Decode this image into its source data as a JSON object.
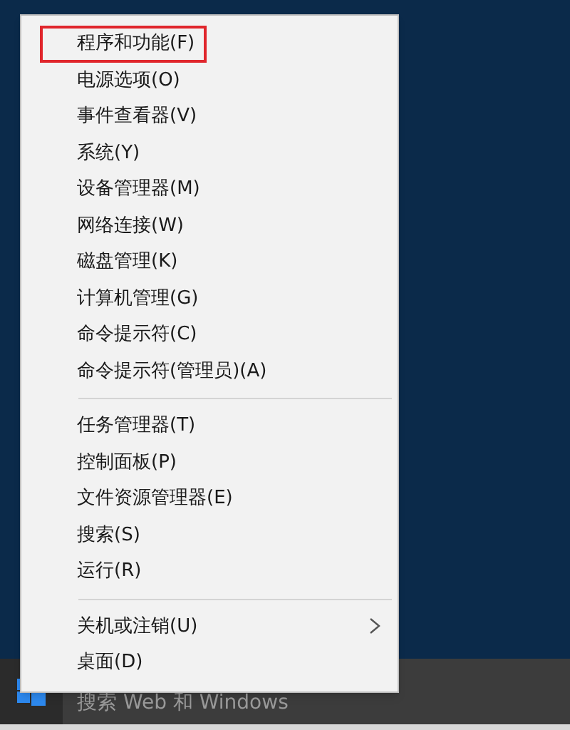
{
  "menu": {
    "groups": [
      {
        "items": [
          {
            "label": "程序和功能(F)",
            "highlighted": true,
            "has_submenu": false
          },
          {
            "label": "电源选项(O)",
            "highlighted": false,
            "has_submenu": false
          },
          {
            "label": "事件查看器(V)",
            "highlighted": false,
            "has_submenu": false
          },
          {
            "label": "系统(Y)",
            "highlighted": false,
            "has_submenu": false
          },
          {
            "label": "设备管理器(M)",
            "highlighted": false,
            "has_submenu": false
          },
          {
            "label": "网络连接(W)",
            "highlighted": false,
            "has_submenu": false
          },
          {
            "label": "磁盘管理(K)",
            "highlighted": false,
            "has_submenu": false
          },
          {
            "label": "计算机管理(G)",
            "highlighted": false,
            "has_submenu": false
          },
          {
            "label": "命令提示符(C)",
            "highlighted": false,
            "has_submenu": false
          },
          {
            "label": "命令提示符(管理员)(A)",
            "highlighted": false,
            "has_submenu": false
          }
        ]
      },
      {
        "items": [
          {
            "label": "任务管理器(T)",
            "highlighted": false,
            "has_submenu": false
          },
          {
            "label": "控制面板(P)",
            "highlighted": false,
            "has_submenu": false
          },
          {
            "label": "文件资源管理器(E)",
            "highlighted": false,
            "has_submenu": false
          },
          {
            "label": "搜索(S)",
            "highlighted": false,
            "has_submenu": false
          },
          {
            "label": "运行(R)",
            "highlighted": false,
            "has_submenu": false
          }
        ]
      },
      {
        "items": [
          {
            "label": "关机或注销(U)",
            "highlighted": false,
            "has_submenu": true
          },
          {
            "label": "桌面(D)",
            "highlighted": false,
            "has_submenu": false
          }
        ]
      }
    ]
  },
  "taskbar": {
    "search_placeholder": "搜索 Web 和 Windows"
  }
}
